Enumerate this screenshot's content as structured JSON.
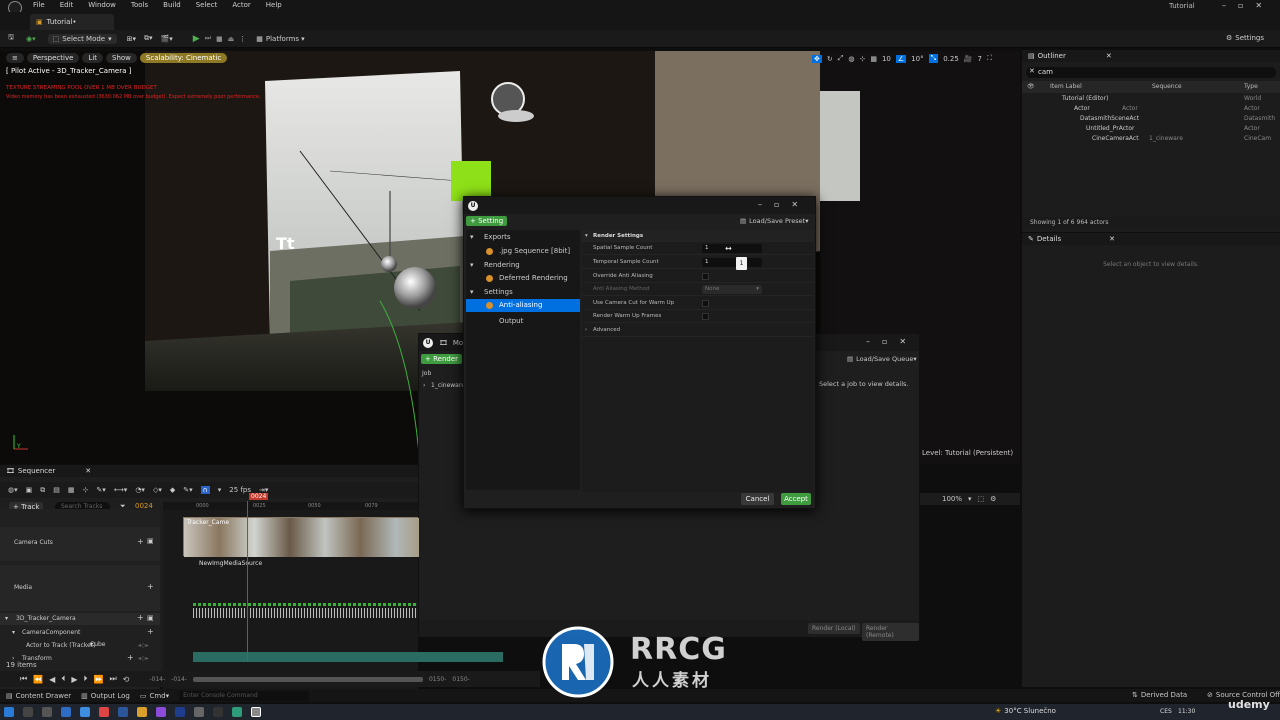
{
  "menubar": {
    "items": [
      "File",
      "Edit",
      "Window",
      "Tools",
      "Build",
      "Select",
      "Actor",
      "Help"
    ],
    "window_title": "Tutorial",
    "tab": "Tutorial•"
  },
  "toolbar": {
    "select_mode": "Select Mode",
    "platforms": "Platforms",
    "settings": "Settings"
  },
  "viewport": {
    "perspective": "Perspective",
    "lit": "Lit",
    "show": "Show",
    "scalability": "Scalability: Cinematic",
    "pilot": "[ Pilot Active - 3D_Tracker_Camera ]",
    "warn1": "TEXTURE STREAMING POOL OVER 1 MB OVER BUDGET",
    "warn2": "Video memory has been exhausted (3630.062 MB over budget). Expect extremely poor performance.",
    "grid_value": "10",
    "angle_value": "10°",
    "scale_value": "0.25",
    "camera_speed": "7",
    "level_label": "Level: Tutorial (Persistent)",
    "axis_label": "Y",
    "zoom_value": "100%"
  },
  "outliner": {
    "title": "Outliner",
    "search_value": "cam",
    "col_label": "Item Label",
    "col_sequence": "Sequence",
    "col_type": "Type",
    "rows": [
      {
        "label": "Tutorial (Editor)",
        "seq": "",
        "type": "World"
      },
      {
        "label": "Actor",
        "seq": "Actor",
        "type": "Actor"
      },
      {
        "label": "DatasmithSceneAct",
        "seq": "",
        "type": "Datasmith"
      },
      {
        "label": "Untitled_PrActor",
        "seq": "",
        "type": "Actor"
      },
      {
        "label": "CineCameraAct",
        "seq": "1_cineware",
        "type": "CineCam"
      }
    ],
    "footer": "Showing 1 of 6 964 actors"
  },
  "details": {
    "title": "Details",
    "empty": "Select an object to view details."
  },
  "render_dialog": {
    "setting_btn": "+ Setting",
    "preset_btn": "Load/Save Preset",
    "tree": [
      {
        "label": "Exports",
        "type": "group"
      },
      {
        "label": ".jpg Sequence [8bit]",
        "type": "item"
      },
      {
        "label": "Rendering",
        "type": "group"
      },
      {
        "label": "Deferred Rendering",
        "type": "item"
      },
      {
        "label": "Settings",
        "type": "group"
      },
      {
        "label": "Anti-aliasing",
        "type": "selected"
      },
      {
        "label": "Output",
        "type": "plain"
      }
    ],
    "section": "Render Settings",
    "props": [
      {
        "name": "Spatial Sample Count",
        "value": "1"
      },
      {
        "name": "Temporal Sample Count",
        "value": "1"
      },
      {
        "name": "Override Anti Aliasing",
        "value": ""
      },
      {
        "name": "Anti Aliasing Method",
        "value": "None"
      },
      {
        "name": "Use Camera Cut for Warm Up",
        "value": ""
      },
      {
        "name": "Render Warm Up Frames",
        "value": ""
      }
    ],
    "advanced": "Advanced",
    "tooltip_value": "1",
    "cancel": "Cancel",
    "accept": "Accept"
  },
  "queue": {
    "title": "Mov",
    "render_btn": "+ Render",
    "job_col": "Job",
    "job": "1_cineware",
    "preset_queue": "Load/Save Queue",
    "empty": "Select a job to view details.",
    "render_local": "Render (Local)",
    "render_remote": "Render (Remote)"
  },
  "sequencer": {
    "title": "Sequencer",
    "fps": "25 fps",
    "track_btn": "+ Track",
    "search_placeholder": "Search Tracks",
    "current_frame": "0024",
    "playhead": "0024",
    "ticks": [
      "0000",
      "0025",
      "0050",
      "0079"
    ],
    "tracks": [
      "Camera Cuts",
      "Media",
      "3D_Tracker_Camera",
      "CameraComponent",
      "Actor to Track (Tracker)",
      "Transform"
    ],
    "cube_label": "Cube",
    "media_source": "NewImgMediaSource",
    "clip_label": "Tracker_Came",
    "items_count": "19 items",
    "range_start": "-014-",
    "range_start2": "-014-",
    "range_end": "0150-",
    "range_end2": "0150-"
  },
  "statusbar": {
    "content_drawer": "Content Drawer",
    "output_log": "Output Log",
    "cmd": "Cmd",
    "console_placeholder": "Enter Console Command",
    "derived": "Derived Data",
    "source_control": "Source Control Off"
  },
  "taskbar": {
    "weather": "30°C  Slunečno",
    "lang": "CES",
    "time": "11:30"
  },
  "watermark": {
    "brand": "RRCG",
    "sub": "人人素材",
    "udemy": "udemy"
  }
}
